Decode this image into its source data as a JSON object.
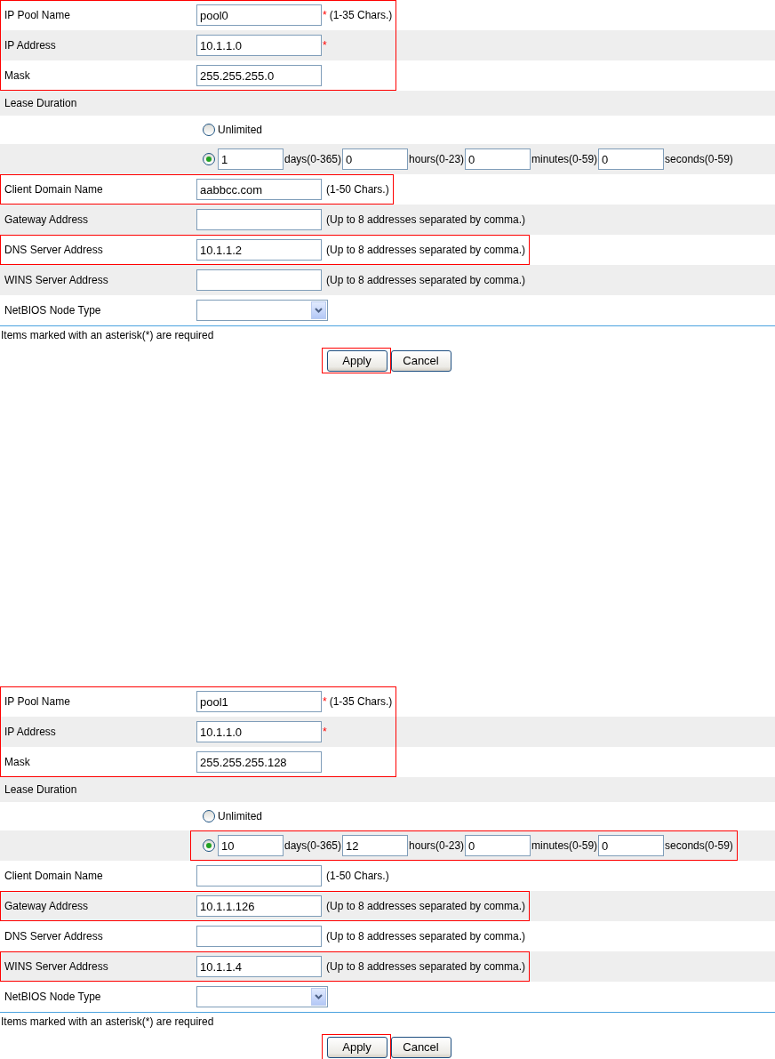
{
  "forms": [
    {
      "rows": [
        {
          "kind": "field",
          "label": "IP Pool Name",
          "value": "pool0",
          "mark": "*",
          "hint": "(1-35 Chars.)",
          "highlighted": true
        },
        {
          "kind": "field",
          "label": "IP Address",
          "value": "10.1.1.0",
          "mark": "*",
          "highlighted": true
        },
        {
          "kind": "field",
          "label": "Mask",
          "value": "255.255.255.0",
          "highlighted": true
        },
        {
          "kind": "section",
          "label": "Lease Duration"
        },
        {
          "kind": "radio",
          "label": "Unlimited",
          "selected": false
        },
        {
          "kind": "duration",
          "selected": true,
          "highlighted": false,
          "parts": [
            {
              "value": "1",
              "unit": "days(0-365)"
            },
            {
              "value": "0",
              "unit": "hours(0-23)"
            },
            {
              "value": "0",
              "unit": "minutes(0-59)"
            },
            {
              "value": "0",
              "unit": "seconds(0-59)"
            }
          ]
        },
        {
          "kind": "field",
          "label": "Client Domain Name",
          "value": "aabbcc.com",
          "hint": "(1-50 Chars.)",
          "highlighted": true
        },
        {
          "kind": "field",
          "label": "Gateway Address",
          "hint": "(Up to 8 addresses separated by comma.)",
          "highlighted": false
        },
        {
          "kind": "field",
          "label": "DNS Server Address",
          "value": "10.1.1.2",
          "hint": "(Up to 8 addresses separated by comma.)",
          "highlighted": true
        },
        {
          "kind": "field",
          "label": "WINS Server Address",
          "hint": "(Up to 8 addresses separated by comma.)",
          "highlighted": false
        },
        {
          "kind": "select",
          "label": "NetBIOS Node Type",
          "highlighted": false
        }
      ],
      "note": "Items marked with an asterisk(*) are required",
      "buttons": [
        {
          "label": "Apply",
          "highlighted": true
        },
        {
          "label": "Cancel",
          "highlighted": false
        }
      ]
    },
    {
      "rows": [
        {
          "kind": "field",
          "label": "IP Pool Name",
          "value": "pool1",
          "mark": "*",
          "hint": "(1-35 Chars.)",
          "highlighted": true
        },
        {
          "kind": "field",
          "label": "IP Address",
          "value": "10.1.1.0",
          "mark": "*",
          "highlighted": true
        },
        {
          "kind": "field",
          "label": "Mask",
          "value": "255.255.255.128",
          "highlighted": true
        },
        {
          "kind": "section",
          "label": "Lease Duration"
        },
        {
          "kind": "radio",
          "label": "Unlimited",
          "selected": false
        },
        {
          "kind": "duration",
          "selected": true,
          "highlighted": true,
          "parts": [
            {
              "value": "10",
              "unit": "days(0-365)"
            },
            {
              "value": "12",
              "unit": "hours(0-23)"
            },
            {
              "value": "0",
              "unit": "minutes(0-59)"
            },
            {
              "value": "0",
              "unit": "seconds(0-59)"
            }
          ]
        },
        {
          "kind": "field",
          "label": "Client Domain Name",
          "hint": "(1-50 Chars.)",
          "highlighted": false
        },
        {
          "kind": "field",
          "label": "Gateway Address",
          "value": "10.1.1.126",
          "hint": "(Up to 8 addresses separated by comma.)",
          "highlighted": true
        },
        {
          "kind": "field",
          "label": "DNS Server Address",
          "hint": "(Up to 8 addresses separated by comma.)",
          "highlighted": false
        },
        {
          "kind": "field",
          "label": "WINS Server Address",
          "value": "10.1.1.4",
          "hint": "(Up to 8 addresses separated by comma.)",
          "highlighted": true
        },
        {
          "kind": "select",
          "label": "NetBIOS Node Type",
          "highlighted": false
        }
      ],
      "note": "Items marked with an asterisk(*) are required",
      "buttons": [
        {
          "label": "Apply",
          "highlighted": true
        },
        {
          "label": "Cancel",
          "highlighted": false
        }
      ]
    }
  ]
}
